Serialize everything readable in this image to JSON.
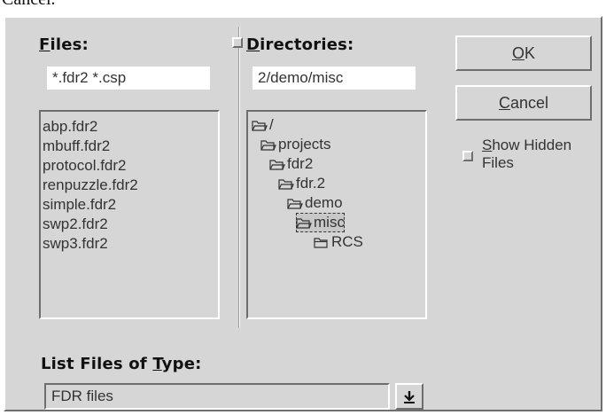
{
  "caption": "Cancel.",
  "files": {
    "label_prefix": "",
    "label_mnemonic": "F",
    "label_rest": "iles:",
    "filter_value": "*.fdr2 *.csp",
    "items": [
      "abp.fdr2",
      "mbuff.fdr2",
      "protocol.fdr2",
      "renpuzzle.fdr2",
      "simple.fdr2",
      "swp2.fdr2",
      "swp3.fdr2"
    ]
  },
  "directories": {
    "label_mnemonic": "D",
    "label_rest": "irectories:",
    "path_value": "2/demo/misc",
    "items": [
      {
        "name": "/",
        "icon": "folder-open-icon"
      },
      {
        "name": "projects",
        "icon": "folder-open-icon"
      },
      {
        "name": "fdr2",
        "icon": "folder-open-icon"
      },
      {
        "name": "fdr.2",
        "icon": "folder-open-icon"
      },
      {
        "name": "demo",
        "icon": "folder-open-icon"
      },
      {
        "name": "misc",
        "icon": "folder-open-icon",
        "selected": true
      },
      {
        "name": "RCS",
        "icon": "folder-closed-icon"
      }
    ]
  },
  "buttons": {
    "ok_mnemonic": "O",
    "ok_rest": "K",
    "cancel_mnemonic": "C",
    "cancel_rest": "ancel"
  },
  "show_hidden": {
    "mnemonic": "S",
    "line1_rest": "how Hidden",
    "line2": "Files",
    "checked": false
  },
  "file_type": {
    "label_prefix": "List Files of ",
    "label_mnemonic": "T",
    "label_rest": "ype:",
    "selected": "FDR files",
    "dropdown_icon": "dropdown-arrow-icon"
  }
}
